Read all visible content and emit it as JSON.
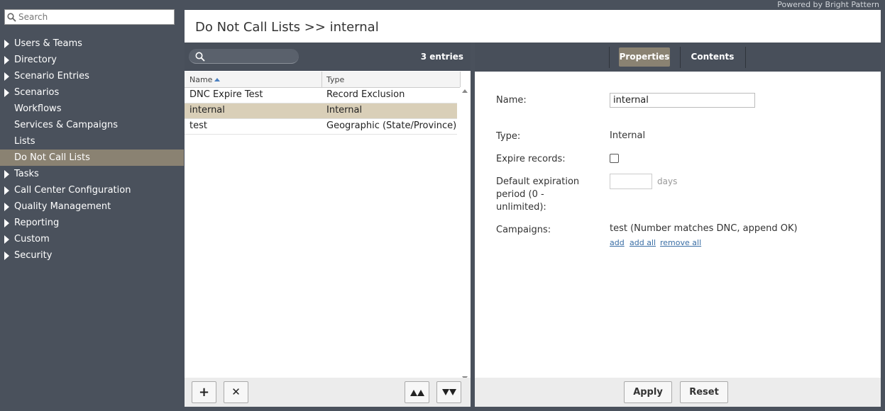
{
  "powered_by": "Powered by Bright Pattern",
  "sidebar": {
    "search_placeholder": "Search",
    "items": [
      {
        "label": "Users & Teams",
        "expandable": true
      },
      {
        "label": "Directory",
        "expandable": true
      },
      {
        "label": "Scenario Entries",
        "expandable": true
      },
      {
        "label": "Scenarios",
        "expandable": true
      },
      {
        "label": "Workflows",
        "expandable": false
      },
      {
        "label": "Services & Campaigns",
        "expandable": false
      },
      {
        "label": "Lists",
        "expandable": false
      },
      {
        "label": "Do Not Call Lists",
        "expandable": false,
        "active": true
      },
      {
        "label": "Tasks",
        "expandable": true
      },
      {
        "label": "Call Center Configuration",
        "expandable": true
      },
      {
        "label": "Quality Management",
        "expandable": true
      },
      {
        "label": "Reporting",
        "expandable": true
      },
      {
        "label": "Custom",
        "expandable": true
      },
      {
        "label": "Security",
        "expandable": true
      }
    ]
  },
  "main": {
    "title": "Do Not Call Lists >> internal"
  },
  "list": {
    "entries_count": "3 entries",
    "columns": {
      "name": "Name",
      "type": "Type"
    },
    "rows": [
      {
        "name": "DNC Expire Test",
        "type": "Record Exclusion"
      },
      {
        "name": "internal",
        "type": "Internal",
        "selected": true
      },
      {
        "name": "test",
        "type": "Geographic (State/Province)"
      }
    ],
    "buttons": {
      "add": "+",
      "delete": "✕",
      "move_top": "⏶⏶",
      "move_bottom": "⏷⏷"
    }
  },
  "props": {
    "tabs": {
      "properties": "Properties",
      "contents": "Contents"
    },
    "name_label": "Name:",
    "name_value": "internal",
    "type_label": "Type:",
    "type_value": "Internal",
    "expire_label": "Expire records:",
    "expire_checked": false,
    "default_exp_label_1": "Default expiration",
    "default_exp_label_2": "period (0 -",
    "default_exp_label_3": "unlimited):",
    "days_unit": "days",
    "campaigns_label": "Campaigns:",
    "campaigns_value": "test (Number matches DNC, append OK)",
    "links": {
      "add": "add",
      "add_all": "add all",
      "remove_all": "remove all"
    },
    "buttons": {
      "apply": "Apply",
      "reset": "Reset"
    }
  }
}
